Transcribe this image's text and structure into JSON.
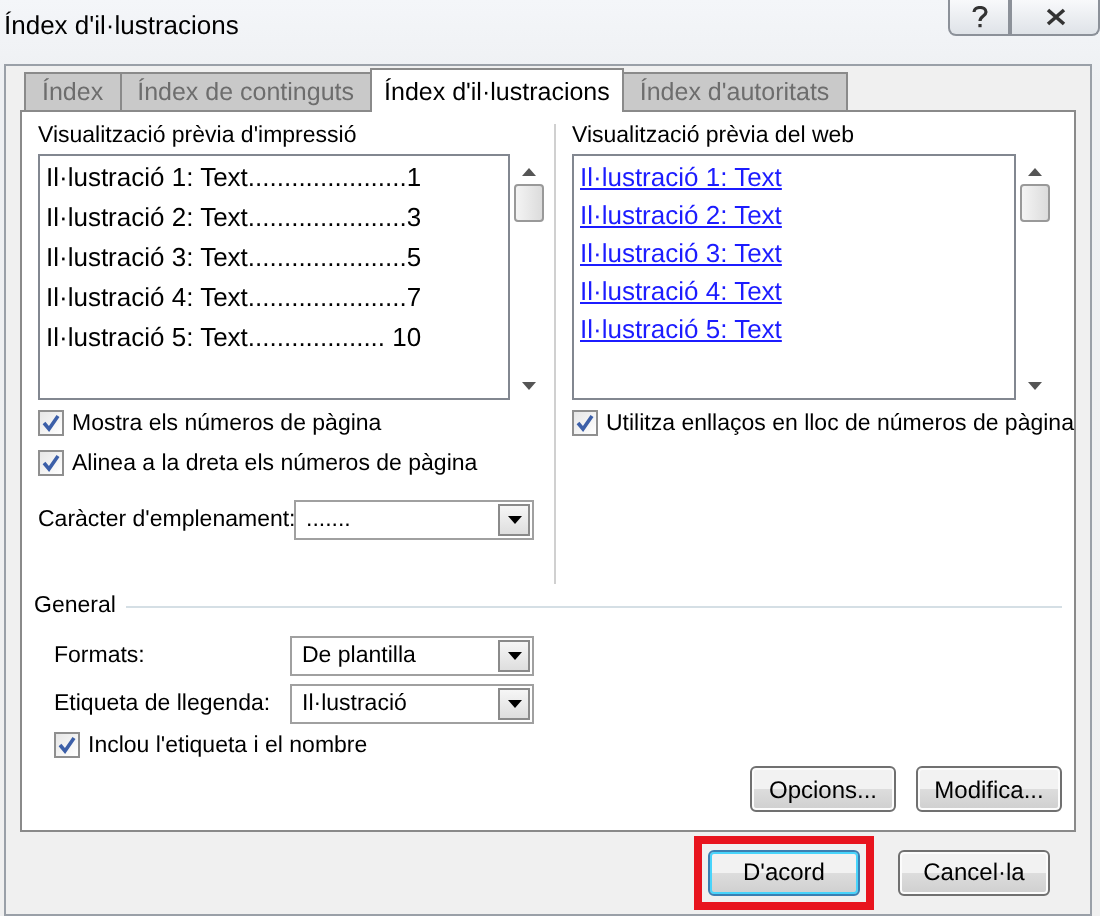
{
  "window": {
    "title": "Índex d'il·lustracions"
  },
  "tabs": [
    {
      "label": "Índex",
      "selected": false
    },
    {
      "label": "Índex de continguts",
      "selected": false
    },
    {
      "label": "Índex d'il·lustracions",
      "selected": true
    },
    {
      "label": "Índex d'autoritats",
      "selected": false
    }
  ],
  "print_preview": {
    "label": "Visualització prèvia d'impressió",
    "lines": [
      "Il·lustració 1: Text......................1",
      "Il·lustració 2: Text......................3",
      "Il·lustració 3: Text......................5",
      "Il·lustració 4: Text......................7",
      "Il·lustració 5: Text................... 10"
    ]
  },
  "print_options": [
    {
      "label": "Mostra els números de pàgina",
      "checked": true
    },
    {
      "label": "Alinea a la dreta els números de pàgina",
      "checked": true
    }
  ],
  "tab_leader": {
    "label": "Caràcter d'emplenament:",
    "value": "......."
  },
  "web_preview": {
    "label": "Visualització prèvia del web",
    "links": [
      "Il·lustració 1: Text",
      "Il·lustració 2: Text",
      "Il·lustració 3: Text",
      "Il·lustració 4: Text",
      "Il·lustració 5: Text"
    ]
  },
  "web_options": [
    {
      "label": "Utilitza enllaços en lloc de números de pàgina",
      "checked": true
    }
  ],
  "general": {
    "title": "General",
    "fields": [
      {
        "label": "Formats:",
        "value": "De plantilla"
      },
      {
        "label": "Etiqueta de llegenda:",
        "value": "Il·lustració"
      }
    ],
    "options": [
      {
        "label": "Inclou l'etiqueta i el nombre",
        "checked": true
      }
    ]
  },
  "panel_buttons": [
    "Opcions...",
    "Modifica..."
  ],
  "dialog_buttons": [
    {
      "label": "D'acord",
      "highlighted": true
    },
    {
      "label": "Cancel·la",
      "highlighted": false
    }
  ]
}
